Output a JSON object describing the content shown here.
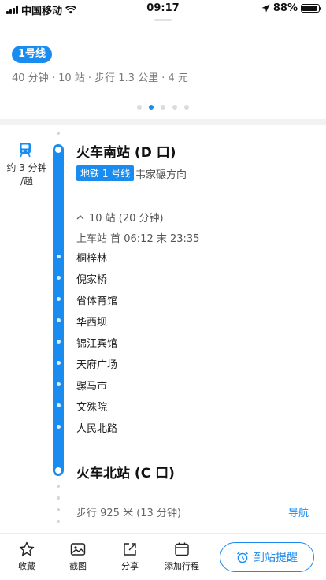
{
  "status_bar": {
    "carrier": "中国移动",
    "time": "09:17",
    "battery": "88%",
    "battery_level": 0.88
  },
  "route": {
    "line_badge": "1号线",
    "summary": "40 分钟 · 10 站 · 步行 1.3 公里 · 4 元",
    "page_count": 5,
    "active_page": 2
  },
  "segment": {
    "wait_time": "约 3 分钟\n/趟",
    "board_station": "火车南站 (D 口)",
    "line_tag": "地铁 1 号线",
    "direction": "韦家碾方向",
    "stops_toggle": "10 站 (20 分钟)",
    "hours": "上车站 首 06:12 末 23:35",
    "stops": [
      "桐梓林",
      "倪家桥",
      "省体育馆",
      "华西坝",
      "锦江宾馆",
      "天府广场",
      "骡马市",
      "文殊院",
      "人民北路"
    ],
    "alight_station": "火车北站 (C 口)"
  },
  "walk": {
    "text": "步行 925 米 (13 分钟)",
    "nav_label": "导航"
  },
  "toolbar": {
    "favorite": "收藏",
    "screenshot": "截图",
    "share": "分享",
    "add_trip": "添加行程",
    "arrival_alert": "到站提醒"
  },
  "colors": {
    "accent": "#1a8cf0"
  }
}
